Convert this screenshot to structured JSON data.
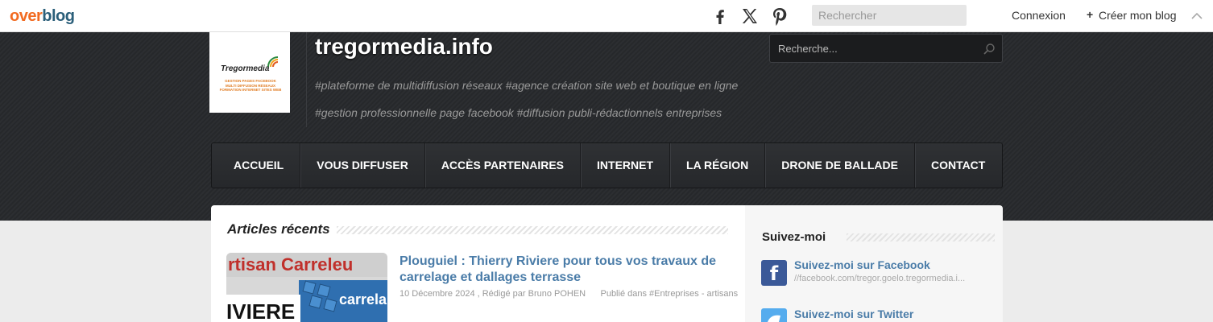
{
  "topbar": {
    "logo_over": "over",
    "logo_blog": "blog",
    "search_placeholder": "Rechercher",
    "login_label": "Connexion",
    "create_plus": "+",
    "create_label": "Créer mon blog"
  },
  "header": {
    "logo_title": "Tregormedia",
    "logo_subtitle": "GESTION PAGES FACEBOOK MULTI DIFFUSION RÉSEAUX FORMATION INTERNET SITES WEB",
    "site_title": "tregormedia.info",
    "tagline_1": "#plateforme de multidiffusion réseaux #agence création site web et boutique en ligne",
    "tagline_2": "#gestion professionnelle page facebook #diffusion publi-rédactionnels entreprises",
    "search_placeholder": "Recherche..."
  },
  "nav": {
    "items": [
      {
        "label": "ACCUEIL"
      },
      {
        "label": "VOUS DIFFUSER"
      },
      {
        "label": "ACCÈS PARTENAIRES"
      },
      {
        "label": "INTERNET"
      },
      {
        "label": "LA RÉGION"
      },
      {
        "label": "DRONE DE BALLADE"
      },
      {
        "label": "CONTACT"
      }
    ]
  },
  "main": {
    "section_title": "Articles récents",
    "article": {
      "thumb_text_1": "rtisan Carreleu",
      "thumb_text_2": "IVIERE",
      "thumb_text_3": "carrela",
      "title": "Plouguiel : Thierry Riviere pour tous vos travaux de carrelage et dallages terrasse",
      "date": "10 Décembre 2024",
      "author": "Rédigé par Bruno POHEN",
      "category": "Publié dans #Entreprises - artisans"
    }
  },
  "sidebar": {
    "title": "Suivez-moi",
    "items": [
      {
        "label": "Suivez-moi sur Facebook",
        "url": "//facebook.com/tregor.goelo.tregormedia.i...",
        "icon": "facebook-icon",
        "glyph": "f"
      },
      {
        "label": "Suivez-moi sur Twitter",
        "url": "",
        "icon": "twitter-icon",
        "glyph": ""
      }
    ]
  },
  "colors": {
    "overblog_orange": "#f26b21",
    "overblog_blue": "#2b5f7a",
    "link_blue": "#4a7ca8",
    "facebook_blue": "#3b5998",
    "twitter_blue": "#55acee"
  }
}
